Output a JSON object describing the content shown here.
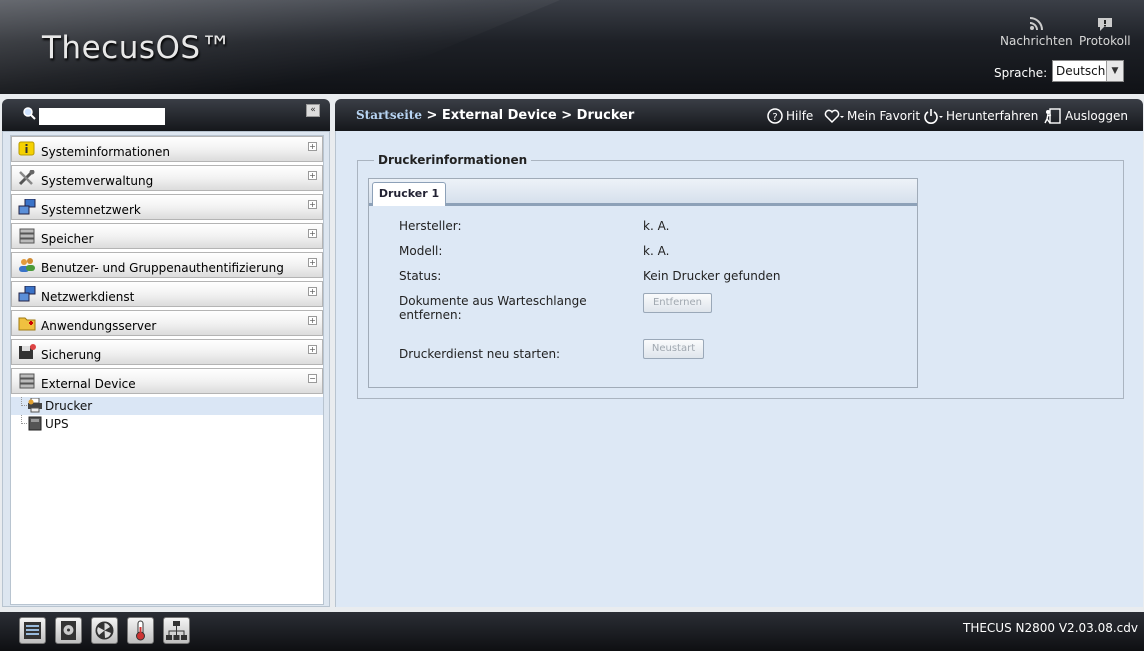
{
  "header": {
    "logo": "ThecusOS™",
    "news_label": "Nachrichten",
    "log_label": "Protokoll",
    "language_label": "Sprache:",
    "language_value": "Deutsch"
  },
  "sidebar": {
    "search_placeholder": "",
    "collapse_label": "«",
    "items": [
      {
        "label": "Systeminformationen",
        "icon": "info-icon"
      },
      {
        "label": "Systemverwaltung",
        "icon": "tools-icon"
      },
      {
        "label": "Systemnetzwerk",
        "icon": "network-icon"
      },
      {
        "label": "Speicher",
        "icon": "storage-icon"
      },
      {
        "label": "Benutzer- und Gruppenauthentifizierung",
        "icon": "users-icon"
      },
      {
        "label": "Netzwerkdienst",
        "icon": "network-service-icon"
      },
      {
        "label": "Anwendungsserver",
        "icon": "folder-icon"
      },
      {
        "label": "Sicherung",
        "icon": "backup-icon"
      },
      {
        "label": "External Device",
        "icon": "external-device-icon"
      }
    ],
    "sub_items": [
      {
        "label": "Drucker",
        "icon": "printer-icon"
      },
      {
        "label": "UPS",
        "icon": "ups-icon"
      }
    ]
  },
  "topbar": {
    "breadcrumb_home": "Startseite",
    "breadcrumb_rest": " > External Device > Drucker",
    "help": "Hilfe",
    "favorite": "Mein Favorit",
    "shutdown": "Herunterfahren",
    "logout": "Ausloggen"
  },
  "printer": {
    "section_title": "Druckerinformationen",
    "tab": "Drucker 1",
    "manufacturer_label": "Hersteller:",
    "manufacturer_value": "k. A.",
    "model_label": "Modell:",
    "model_value": "k. A.",
    "status_label": "Status:",
    "status_value": "Kein Drucker gefunden",
    "queue_label": "Dokumente aus Warteschlange entfernen:",
    "remove_button": "Entfernen",
    "restart_label": "Druckerdienst neu starten:",
    "restart_button": "Neustart"
  },
  "footer": {
    "version": "THECUS N2800 V2.03.08.cdv"
  }
}
